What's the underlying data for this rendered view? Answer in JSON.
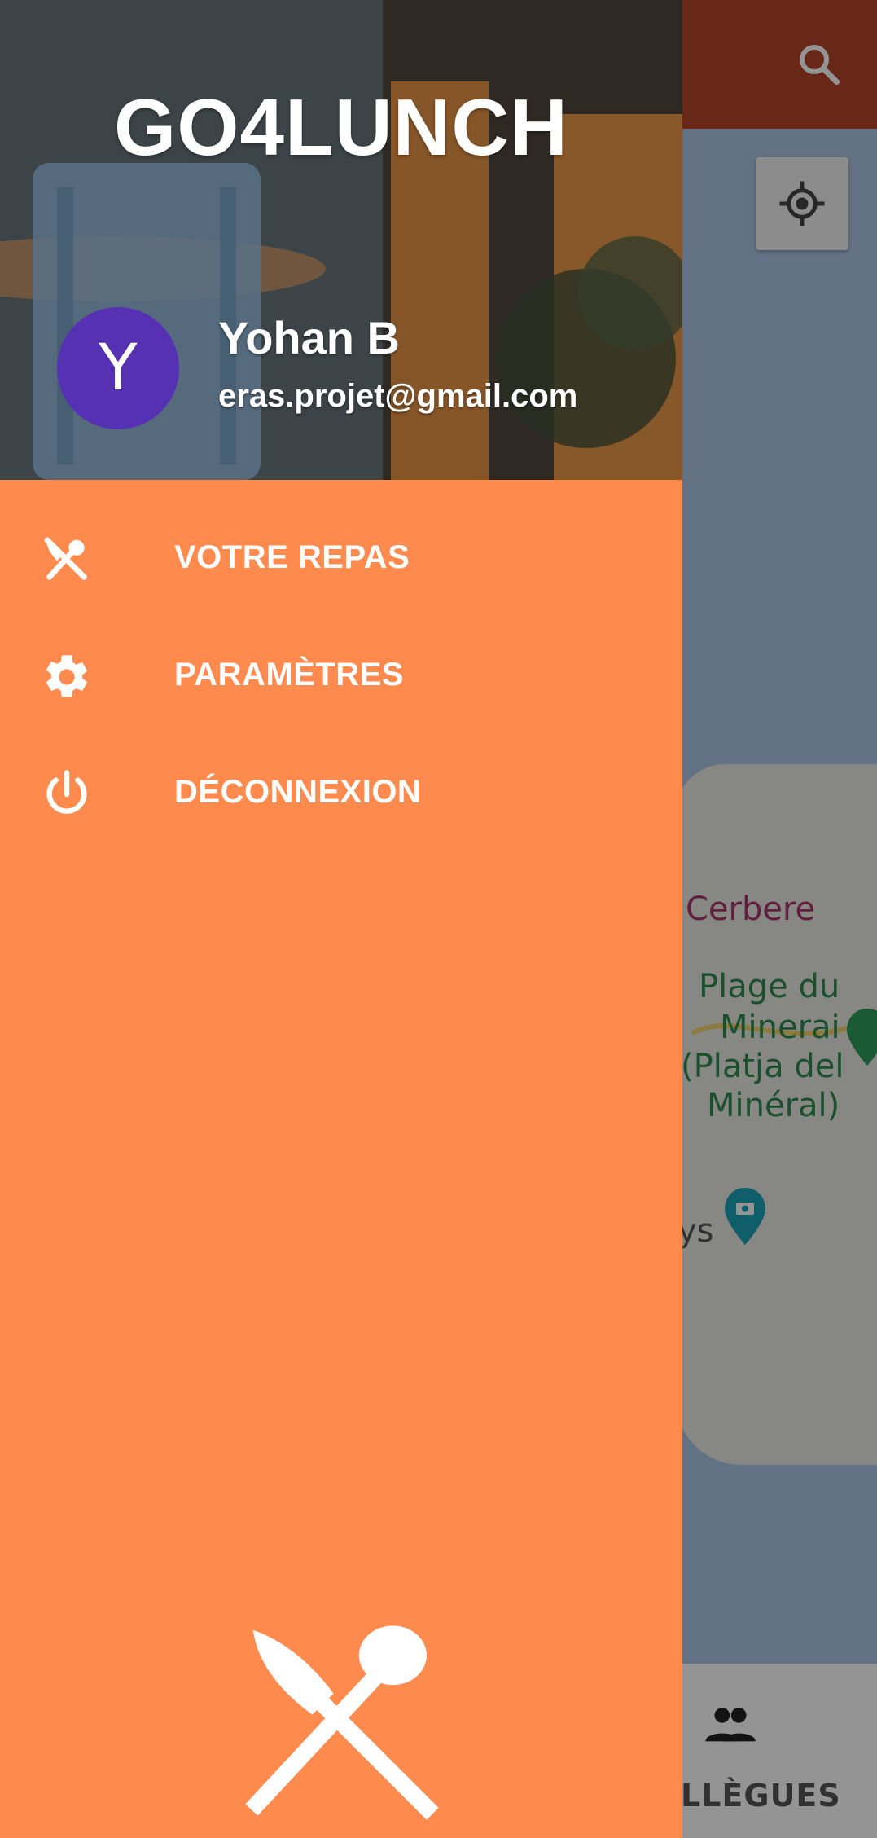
{
  "app": {
    "title": "GO4LUNCH"
  },
  "colors": {
    "drawer_background": "#ff8a4d",
    "toolbar": "#b5442a",
    "avatar": "#5631b4",
    "water": "#a9c4e4",
    "land": "#e8e8e4"
  },
  "user": {
    "initial": "Y",
    "name": "Yohan B",
    "email": "eras.projet@gmail.com"
  },
  "menu": {
    "items": [
      {
        "label": "VOTRE REPAS",
        "icon": "fork-knife-icon"
      },
      {
        "label": "PARAMÈTRES",
        "icon": "settings-gear-icon"
      },
      {
        "label": "DÉCONNEXION",
        "icon": "power-icon"
      }
    ]
  },
  "map": {
    "labels": {
      "town": "Cerbere",
      "beach_line1": "Plage du",
      "beach_line2": "Minerai",
      "beach_line3": "(Platja del",
      "beach_line4": "Minéral)",
      "partial": "ys"
    }
  },
  "bottom_nav": {
    "workmates_label": "LLÈGUES",
    "workmates_icon": "people-icon"
  },
  "icons": {
    "search": "search-icon",
    "locate": "my-location-icon",
    "logo": "fork-spoon-logo-icon"
  }
}
